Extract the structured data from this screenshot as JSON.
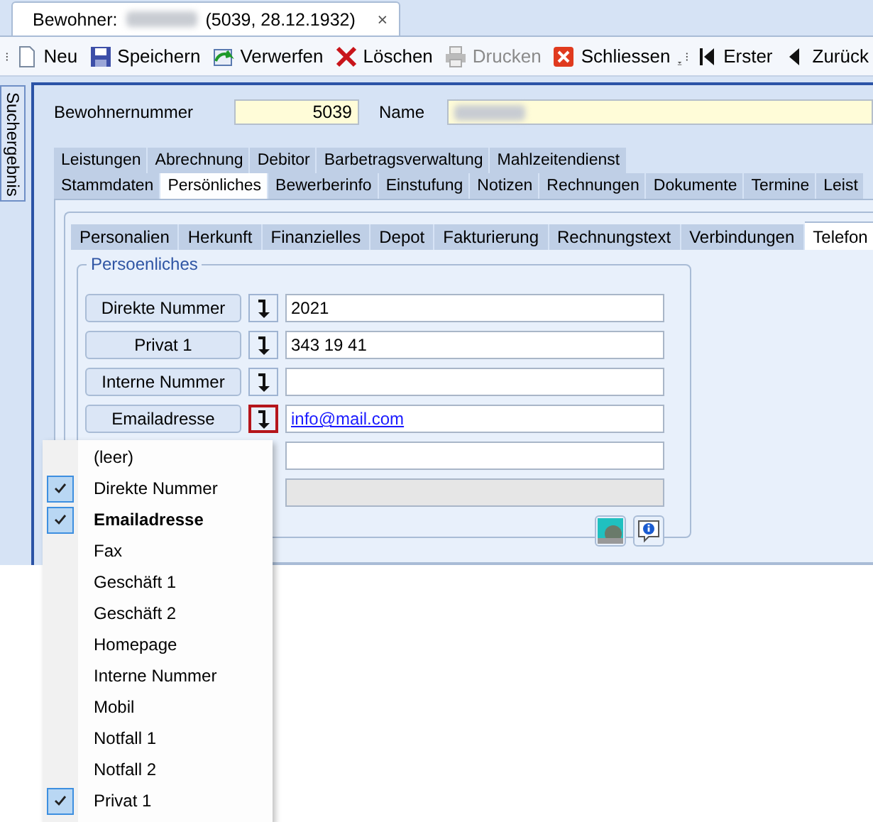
{
  "document_tab": {
    "prefix": "Bewohner:",
    "suffix": "(5039, 28.12.1932)",
    "close": "×"
  },
  "toolbar": {
    "groups": [
      [
        {
          "kind": "new",
          "label": "Neu",
          "disabled": false
        },
        {
          "kind": "save",
          "label": "Speichern",
          "disabled": false
        },
        {
          "kind": "discard",
          "label": "Verwerfen",
          "disabled": false
        },
        {
          "kind": "delete",
          "label": "Löschen",
          "disabled": false
        },
        {
          "kind": "print",
          "label": "Drucken",
          "disabled": true
        },
        {
          "kind": "close",
          "label": "Schliessen",
          "disabled": false
        }
      ],
      [
        {
          "kind": "first",
          "label": "Erster",
          "disabled": false
        },
        {
          "kind": "back",
          "label": "Zurück",
          "disabled": false
        }
      ]
    ]
  },
  "side_tab": "Suchergebnis",
  "record": {
    "number_label": "Bewohnernummer",
    "number": "5039",
    "name_label": "Name"
  },
  "main_tabs": [
    [
      {
        "label": "Leistungen",
        "selected": false
      },
      {
        "label": "Abrechnung",
        "selected": false
      },
      {
        "label": "Debitor",
        "selected": false
      },
      {
        "label": "Barbetragsverwaltung",
        "selected": false
      },
      {
        "label": "Mahlzeitendienst",
        "selected": false
      }
    ],
    [
      {
        "label": "Stammdaten",
        "selected": false
      },
      {
        "label": "Persönliches",
        "selected": true
      },
      {
        "label": "Bewerberinfo",
        "selected": false
      },
      {
        "label": "Einstufung",
        "selected": false
      },
      {
        "label": "Notizen",
        "selected": false
      },
      {
        "label": "Rechnungen",
        "selected": false
      },
      {
        "label": "Dokumente",
        "selected": false
      },
      {
        "label": "Termine",
        "selected": false
      },
      {
        "label": "Leist"
      }
    ]
  ],
  "sub_tabs": [
    {
      "label": "Personalien",
      "selected": false
    },
    {
      "label": "Herkunft",
      "selected": false
    },
    {
      "label": "Finanzielles",
      "selected": false
    },
    {
      "label": "Depot",
      "selected": false
    },
    {
      "label": "Fakturierung",
      "selected": false
    },
    {
      "label": "Rechnungstext",
      "selected": false
    },
    {
      "label": "Verbindungen",
      "selected": false
    },
    {
      "label": "Telefon",
      "selected": true
    }
  ],
  "group": {
    "title": "Persoenliches",
    "rows": [
      {
        "kind": "phone",
        "label": "Direkte Nummer",
        "value": "2021",
        "highlighted": false,
        "disabled": false
      },
      {
        "kind": "phone",
        "label": "Privat 1",
        "value": "343 19 41",
        "highlighted": false,
        "disabled": false
      },
      {
        "label": "Interne Nummer",
        "highlighted": false,
        "disabled": false
      },
      {
        "kind": "email",
        "label": "Emailadresse",
        "value": "info@mail.com",
        "highlighted": true,
        "disabled": false
      },
      {
        "disabled": false
      },
      {
        "disabled": true
      }
    ]
  },
  "menu": [
    {
      "label": "(leer)",
      "checked": false,
      "selected": false
    },
    {
      "label": "Direkte Nummer",
      "checked": true,
      "selected": false
    },
    {
      "label": "Emailadresse",
      "checked": true,
      "selected": true
    },
    {
      "label": "Fax",
      "checked": false,
      "selected": false
    },
    {
      "label": "Geschäft 1",
      "checked": false,
      "selected": false
    },
    {
      "label": "Geschäft 2",
      "checked": false,
      "selected": false
    },
    {
      "label": "Homepage",
      "checked": false,
      "selected": false
    },
    {
      "label": "Interne Nummer",
      "checked": false,
      "selected": false
    },
    {
      "label": "Mobil",
      "checked": false,
      "selected": false
    },
    {
      "label": "Notfall 1",
      "checked": false,
      "selected": false
    },
    {
      "label": "Notfall 2",
      "checked": false,
      "selected": false
    },
    {
      "label": "Privat 1",
      "checked": true,
      "selected": false
    }
  ]
}
